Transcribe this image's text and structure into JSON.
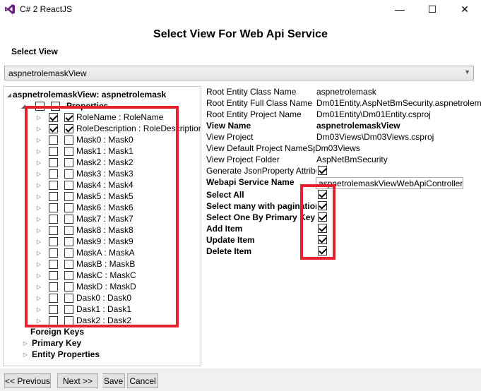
{
  "window": {
    "title": "C# 2 ReactJS",
    "minimize_glyph": "—",
    "maximize_glyph": "☐",
    "close_glyph": "✕"
  },
  "dialog": {
    "heading": "Select View For Web Api Service",
    "select_view_label": "Select View",
    "selected_view": "aspnetrolemaskView"
  },
  "tree": {
    "root_label": "aspnetrolemaskView: aspnetrolemask",
    "properties_label": "Properties",
    "properties": [
      {
        "label": "RoleName : RoleName",
        "checked": true
      },
      {
        "label": "RoleDescription : RoleDescription",
        "checked": true
      },
      {
        "label": "Mask0 : Mask0",
        "checked": false
      },
      {
        "label": "Mask1 : Mask1",
        "checked": false
      },
      {
        "label": "Mask2 : Mask2",
        "checked": false
      },
      {
        "label": "Mask3 : Mask3",
        "checked": false
      },
      {
        "label": "Mask4 : Mask4",
        "checked": false
      },
      {
        "label": "Mask5 : Mask5",
        "checked": false
      },
      {
        "label": "Mask6 : Mask6",
        "checked": false
      },
      {
        "label": "Mask7 : Mask7",
        "checked": false
      },
      {
        "label": "Mask8 : Mask8",
        "checked": false
      },
      {
        "label": "Mask9 : Mask9",
        "checked": false
      },
      {
        "label": "MaskA : MaskA",
        "checked": false
      },
      {
        "label": "MaskB : MaskB",
        "checked": false
      },
      {
        "label": "MaskC : MaskC",
        "checked": false
      },
      {
        "label": "MaskD : MaskD",
        "checked": false
      },
      {
        "label": "Dask0 : Dask0",
        "checked": false
      },
      {
        "label": "Dask1 : Dask1",
        "checked": false
      },
      {
        "label": "Dask2 : Dask2",
        "checked": false
      }
    ],
    "foreign_keys_label": "Foreign Keys",
    "primary_key_label": "Primary Key",
    "entity_properties_label": "Entity Properties"
  },
  "details": {
    "root_entity_class_name_label": "Root Entity Class Name",
    "root_entity_class_name": "aspnetrolemask",
    "root_entity_full_class_name_label": "Root Entity Full Class Name",
    "root_entity_full_class_name": "Dm01Entity.AspNetBmSecurity.aspnetrolemask",
    "root_entity_project_name_label": "Root Entity Project Name",
    "root_entity_project_name": "Dm01Entity\\Dm01Entity.csproj",
    "view_name_label": "View Name",
    "view_name": "aspnetrolemaskView",
    "view_project_label": "View Project",
    "view_project": "Dm03Views\\Dm03Views.csproj",
    "view_default_project_namespace_label": "View Default Project NameSpace",
    "view_default_project_namespace": "Dm03Views",
    "view_project_folder_label": "View Project Folder",
    "view_project_folder": "AspNetBmSecurity",
    "generate_json_property_label": "Generate JsonProperty Attribute",
    "generate_json_property_checked": true,
    "webapi_service_name_label": "Webapi Service Name",
    "webapi_service_name": "aspnetrolemaskViewWebApiController",
    "operations": [
      {
        "label": "Select All",
        "checked": true
      },
      {
        "label": "Select many with pagination",
        "checked": true
      },
      {
        "label": "Select One By Primary Key",
        "checked": true
      },
      {
        "label": "Add Item",
        "checked": true
      },
      {
        "label": "Update Item",
        "checked": true
      },
      {
        "label": "Delete Item",
        "checked": true
      }
    ]
  },
  "buttons": {
    "previous": "<< Previous",
    "next": "Next >>",
    "save": "Save",
    "cancel": "Cancel"
  },
  "colors": {
    "highlight": "#e8212e",
    "vs_purple": "#68217a"
  }
}
